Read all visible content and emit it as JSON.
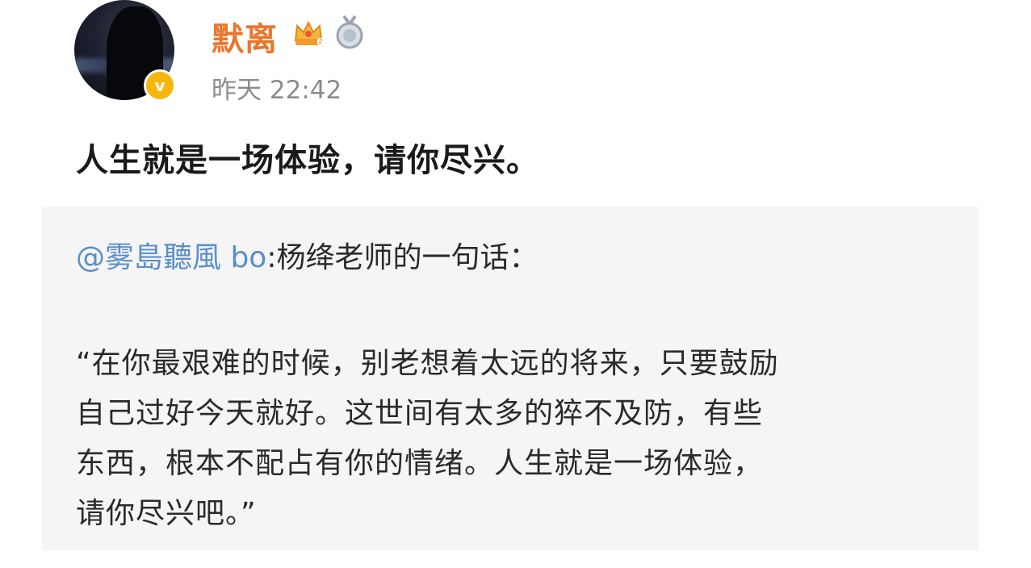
{
  "post": {
    "author": {
      "name": "默离",
      "verified": true,
      "verified_mark": "v",
      "badges": [
        "crown-level-badge",
        "medal-badge"
      ],
      "crown_level": "6",
      "accent_color": "#e8772e"
    },
    "timestamp": "昨天 22:42",
    "text": "人生就是一场体验，请你尽兴。",
    "repost": {
      "mention": "@雾島聽風 bo",
      "header_text": ":杨绛老师的一句话：",
      "mention_color": "#5b8fc8",
      "quote_lines": [
        "“在你最艰难的时候，别老想着太远的将来，只要鼓励",
        "自己过好今天就好。这世间有太多的猝不及防，有些",
        "东西，根本不配占有你的情绪。人生就是一场体验，",
        "请你尽兴吧。”"
      ]
    }
  }
}
